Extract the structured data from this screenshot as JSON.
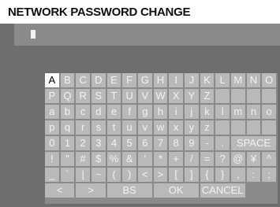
{
  "title": "NETWORK PASSWORD CHANGE",
  "password_value": "",
  "colors": {
    "background": "#6e6e6e",
    "panel": "#8a8a8a",
    "key": "#b9b9b9",
    "key_text": "#f3f3f3",
    "selected_key": "#ffffff",
    "selected_text": "#000000"
  },
  "keyboard": {
    "rows": [
      [
        "A",
        "B",
        "C",
        "D",
        "E",
        "F",
        "G",
        "H",
        "I",
        "J",
        "K",
        "L",
        "M",
        "N",
        "O"
      ],
      [
        "P",
        "Q",
        "R",
        "S",
        "T",
        "U",
        "V",
        "W",
        "X",
        "Y",
        "Z"
      ],
      [
        "a",
        "b",
        "c",
        "d",
        "e",
        "f",
        "g",
        "h",
        "i",
        "j",
        "k",
        "l",
        "m",
        "n",
        "o"
      ],
      [
        "p",
        "q",
        "r",
        "s",
        "t",
        "u",
        "v",
        "w",
        "x",
        "y",
        "z"
      ],
      [
        "0",
        "1",
        "2",
        "3",
        "4",
        "5",
        "6",
        "7",
        "8",
        "9",
        "-",
        ".",
        "SPACE"
      ],
      [
        "!",
        "\"",
        "#",
        "$",
        "%",
        "&",
        "'",
        "*",
        "+",
        "/",
        "=",
        "?",
        "@",
        "¥",
        "^"
      ],
      [
        "_",
        "`",
        "|",
        "~",
        "(",
        ")",
        "<",
        ">",
        "[",
        "]",
        "{",
        "}",
        ",",
        ":",
        ";"
      ]
    ],
    "nav": {
      "left": "<",
      "right": ">",
      "backspace": "BS",
      "ok": "OK",
      "cancel": "CANCEL"
    },
    "selected_key": "A"
  }
}
